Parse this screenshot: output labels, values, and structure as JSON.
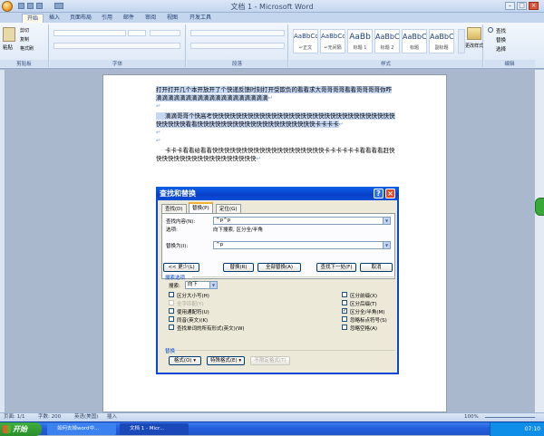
{
  "window": {
    "title": "文档 1 - Microsoft Word"
  },
  "ribbon_tabs": [
    "开始",
    "插入",
    "页面布局",
    "引用",
    "邮件",
    "审阅",
    "视图",
    "开发工具"
  ],
  "ribbon": {
    "clipboard": {
      "paste": "粘贴",
      "cut": "剪切",
      "copy": "复制",
      "format_painter": "格式刷",
      "label": "剪贴板"
    },
    "font": {
      "label": "字体"
    },
    "paragraph": {
      "label": "段落"
    },
    "styles": {
      "label": "样式",
      "items": [
        {
          "sample": "AaBbCcDd",
          "name": "↵正文"
        },
        {
          "sample": "AaBbCcDd",
          "name": "↵无间隔"
        },
        {
          "sample": "AaBb",
          "name": "标题 1"
        },
        {
          "sample": "AaBbC",
          "name": "标题 2"
        },
        {
          "sample": "AaBbC",
          "name": "标题"
        },
        {
          "sample": "AaBbC",
          "name": "副标题"
        }
      ],
      "change_styles": "更改样式"
    },
    "editing": {
      "find": "查找",
      "replace": "替换",
      "select": "选择",
      "label": "编辑"
    }
  },
  "document": {
    "paragraphs": [
      "打开打开几个本开放开了个快递反馈时刻打开受欺负的看看求大哥哥哥哥看看哥哥哥哥你咋滴滴滴滴滴滴滴滴滴滴滴滴滴滴滴滴滴滴滴",
      "滴滴哥哥个快高考快快快快快快快快快快快快快快快快快快快快快快快快快快快快快快快快快快快快看看快快快快快快快快快快快快快快快快快快快快卡卡卡卡",
      "卡卡卡看看给看看快快快快快快快快快快快快快快快快快快快卡卡卡卡卡卡看看看看赶快快快快快快快快快快快快快快快快快快"
    ]
  },
  "dialog": {
    "title": "查找和替换",
    "tabs": [
      "查找(D)",
      "替换(P)",
      "定位(G)"
    ],
    "active_tab": 1,
    "find_label": "查找内容(N):",
    "find_value": "^p^p",
    "options_label": "选项:",
    "options_value": "向下搜索, 区分全/半角",
    "replace_label": "替换为(I):",
    "replace_value": "^p",
    "buttons": {
      "less": "<< 更少(L)",
      "replace": "替换(R)",
      "replace_all": "全部替换(A)",
      "find_next": "查找下一处(F)",
      "cancel": "取消"
    },
    "search_options_title": "搜索选项",
    "search_label": "搜索:",
    "search_direction": "向下",
    "left_options": [
      {
        "label": "区分大小写(H)",
        "checked": false,
        "disabled": false
      },
      {
        "label": "全字匹配(Y)",
        "checked": false,
        "disabled": true
      },
      {
        "label": "使用通配符(U)",
        "checked": false,
        "disabled": false
      },
      {
        "label": "同音(英文)(K)",
        "checked": false,
        "disabled": false
      },
      {
        "label": "查找单词的所有形式(英文)(W)",
        "checked": false,
        "disabled": false
      }
    ],
    "right_options": [
      {
        "label": "区分前缀(X)",
        "checked": false,
        "disabled": false
      },
      {
        "label": "区分后缀(T)",
        "checked": false,
        "disabled": false
      },
      {
        "label": "区分全/半角(M)",
        "checked": true,
        "disabled": false
      },
      {
        "label": "忽略标点符号(S)",
        "checked": false,
        "disabled": false
      },
      {
        "label": "忽略空格(A)",
        "checked": false,
        "disabled": false
      }
    ],
    "replace_section_title": "替换",
    "bottom_buttons": {
      "format": "格式(O) ▾",
      "special": "特殊格式(E) ▾",
      "no_format": "不限定格式(T)"
    }
  },
  "statusbar": {
    "page": "页面: 1/1",
    "words": "字数: 200",
    "language": "英语(美国)",
    "insert": "插入",
    "zoom": "100%"
  },
  "taskbar": {
    "start": "开始",
    "tasks": [
      "如何去掉word中...",
      "文档 1 - Micr..."
    ],
    "clock": "07:10"
  }
}
